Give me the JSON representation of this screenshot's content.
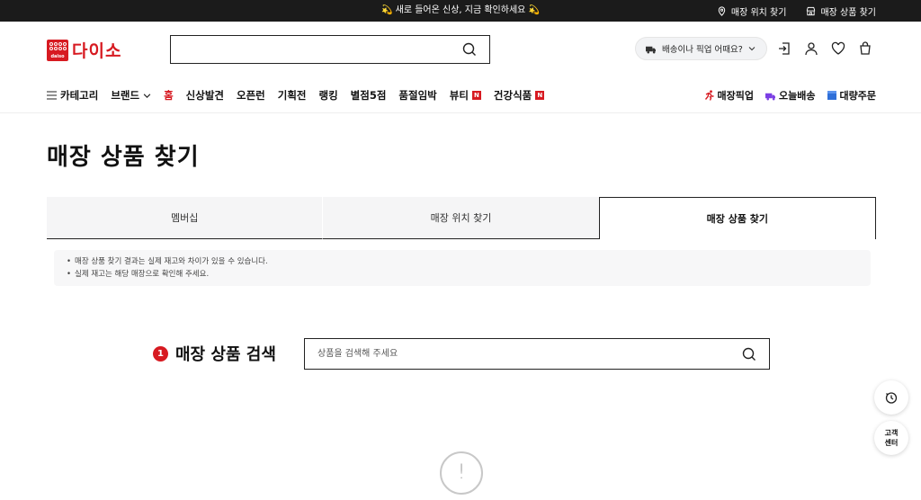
{
  "topbar": {
    "promo": "💫 새로 들어온 신상, 지금 확인하세요 💫",
    "links": [
      "매장 위치 찾기",
      "매장 상품 찾기"
    ]
  },
  "header": {
    "logo_text": "다이소",
    "logo_sub": "daiso",
    "search_placeholder": "",
    "delivery_pill": "배송이나 픽업 어때요?"
  },
  "nav": {
    "left": [
      {
        "label": "카테고리"
      },
      {
        "label": "브랜드"
      },
      {
        "label": "홈"
      },
      {
        "label": "신상발견"
      },
      {
        "label": "오픈런"
      },
      {
        "label": "기획전"
      },
      {
        "label": "랭킹"
      },
      {
        "label": "별점5점"
      },
      {
        "label": "품절임박"
      },
      {
        "label": "뷰티",
        "badge": "N"
      },
      {
        "label": "건강식품",
        "badge": "N"
      }
    ],
    "right": [
      "매장픽업",
      "오늘배송",
      "대량주문"
    ]
  },
  "page": {
    "title": "매장 상품 찾기",
    "tabs": [
      "멤버십",
      "매장 위치 찾기",
      "매장 상품 찾기"
    ],
    "notice": [
      "매장 상품 찾기 결과는 실제 재고와 차이가 있을 수 있습니다.",
      "실제 재고는 해당 매장으로 확인해 주세요."
    ],
    "search": {
      "step": "1",
      "title": "매장 상품 검색",
      "placeholder": "상품을 검색해 주세요"
    }
  },
  "floating": {
    "cs_label": "고객\n센터"
  },
  "empty": {
    "icon_glyph": "!"
  },
  "colors": {
    "brand": "#d71a21",
    "topbar": "#1b1b1b"
  }
}
